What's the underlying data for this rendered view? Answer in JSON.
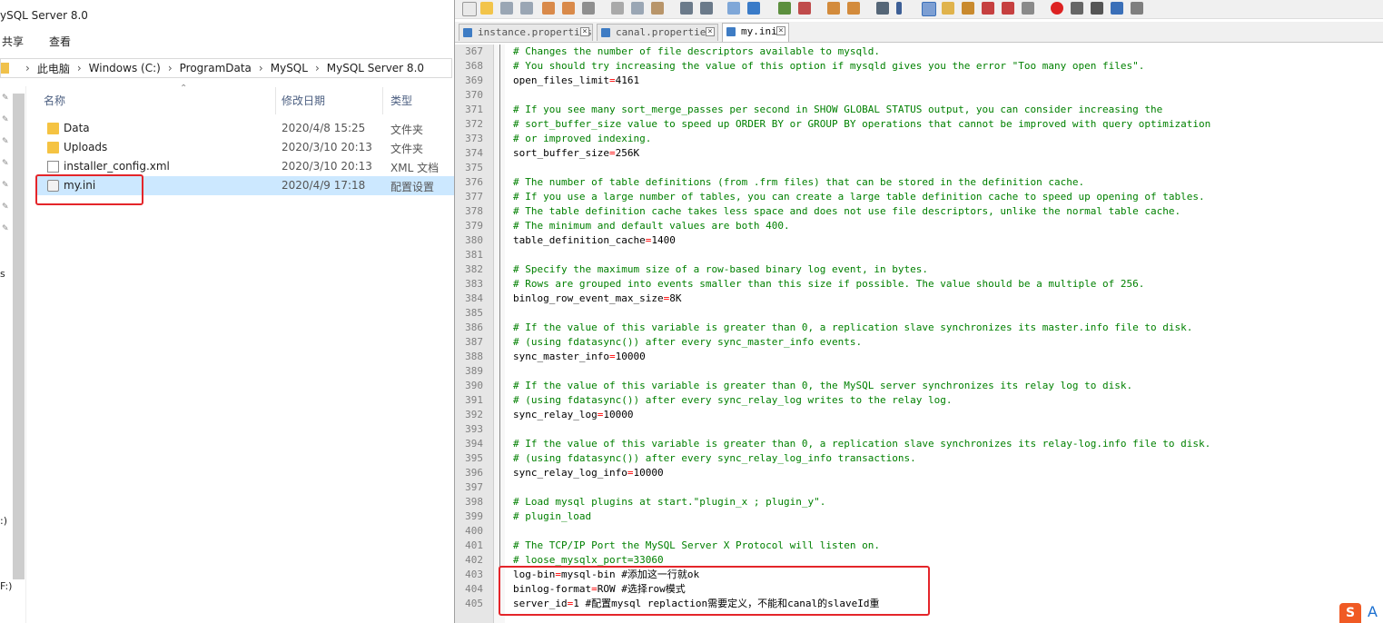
{
  "explorer": {
    "title": "ySQL Server 8.0",
    "ribbon_tabs": [
      "共享",
      "查看"
    ],
    "breadcrumb": [
      "此电脑",
      "Windows (C:)",
      "ProgramData",
      "MySQL",
      "MySQL Server 8.0"
    ],
    "nav_fragments": [
      "s",
      ":)",
      "F:)"
    ],
    "columns": {
      "name": "名称",
      "modified": "修改日期",
      "type": "类型"
    },
    "files": [
      {
        "name": "Data",
        "date": "2020/4/8 15:25",
        "type": "文件夹",
        "icon": "folder-icon"
      },
      {
        "name": "Uploads",
        "date": "2020/3/10 20:13",
        "type": "文件夹",
        "icon": "folder-icon"
      },
      {
        "name": "installer_config.xml",
        "date": "2020/3/10 20:13",
        "type": "XML 文档",
        "icon": "xml-file-icon"
      },
      {
        "name": "my.ini",
        "date": "2020/4/9 17:18",
        "type": "配置设置",
        "icon": "config-file-icon",
        "selected": true
      }
    ]
  },
  "editor": {
    "tabs": [
      {
        "label": "instance.properties",
        "active": false
      },
      {
        "label": "canal.properties",
        "active": false
      },
      {
        "label": "my.ini",
        "active": true
      }
    ],
    "lines": [
      {
        "n": "367",
        "t": "# Changes the number of file descriptors available to mysqld."
      },
      {
        "n": "368",
        "t": "# You should try increasing the value of this option if mysqld gives you the error \"Too many open files\"."
      },
      {
        "n": "369",
        "k": "open_files_limit",
        "v": "4161"
      },
      {
        "n": "370",
        "t": ""
      },
      {
        "n": "371",
        "t": "# If you see many sort_merge_passes per second in SHOW GLOBAL STATUS output, you can consider increasing the"
      },
      {
        "n": "372",
        "t": "# sort_buffer_size value to speed up ORDER BY or GROUP BY operations that cannot be improved with query optimization"
      },
      {
        "n": "373",
        "t": "# or improved indexing."
      },
      {
        "n": "374",
        "k": "sort_buffer_size",
        "v": "256K"
      },
      {
        "n": "375",
        "t": ""
      },
      {
        "n": "376",
        "t": "# The number of table definitions (from .frm files) that can be stored in the definition cache."
      },
      {
        "n": "377",
        "t": "# If you use a large number of tables, you can create a large table definition cache to speed up opening of tables."
      },
      {
        "n": "378",
        "t": "# The table definition cache takes less space and does not use file descriptors, unlike the normal table cache."
      },
      {
        "n": "379",
        "t": "# The minimum and default values are both 400."
      },
      {
        "n": "380",
        "k": "table_definition_cache",
        "v": "1400"
      },
      {
        "n": "381",
        "t": ""
      },
      {
        "n": "382",
        "t": "# Specify the maximum size of a row-based binary log event, in bytes."
      },
      {
        "n": "383",
        "t": "# Rows are grouped into events smaller than this size if possible. The value should be a multiple of 256."
      },
      {
        "n": "384",
        "k": "binlog_row_event_max_size",
        "v": "8K"
      },
      {
        "n": "385",
        "t": ""
      },
      {
        "n": "386",
        "t": "# If the value of this variable is greater than 0, a replication slave synchronizes its master.info file to disk."
      },
      {
        "n": "387",
        "t": "# (using fdatasync()) after every sync_master_info events."
      },
      {
        "n": "388",
        "k": "sync_master_info",
        "v": "10000"
      },
      {
        "n": "389",
        "t": ""
      },
      {
        "n": "390",
        "t": "# If the value of this variable is greater than 0, the MySQL server synchronizes its relay log to disk."
      },
      {
        "n": "391",
        "t": "# (using fdatasync()) after every sync_relay_log writes to the relay log."
      },
      {
        "n": "392",
        "k": "sync_relay_log",
        "v": "10000"
      },
      {
        "n": "393",
        "t": ""
      },
      {
        "n": "394",
        "t": "# If the value of this variable is greater than 0, a replication slave synchronizes its relay-log.info file to disk."
      },
      {
        "n": "395",
        "t": "# (using fdatasync()) after every sync_relay_log_info transactions."
      },
      {
        "n": "396",
        "k": "sync_relay_log_info",
        "v": "10000"
      },
      {
        "n": "397",
        "t": ""
      },
      {
        "n": "398",
        "t": "# Load mysql plugins at start.\"plugin_x ; plugin_y\"."
      },
      {
        "n": "399",
        "t": "# plugin_load"
      },
      {
        "n": "400",
        "t": ""
      },
      {
        "n": "401",
        "t": "# The TCP/IP Port the MySQL Server X Protocol will listen on."
      },
      {
        "n": "402",
        "t": "# loose_mysqlx_port=33060"
      },
      {
        "n": "403",
        "k": "log-bin",
        "v": "mysql-bin #添加这一行就ok"
      },
      {
        "n": "404",
        "k": "binlog-format",
        "v": "ROW #选择row模式"
      },
      {
        "n": "405",
        "k": "server_id",
        "v": "1 #配置mysql replaction需要定义，不能和canal的slaveId重"
      }
    ]
  },
  "ime": {
    "badge": "S",
    "letter": "A"
  }
}
